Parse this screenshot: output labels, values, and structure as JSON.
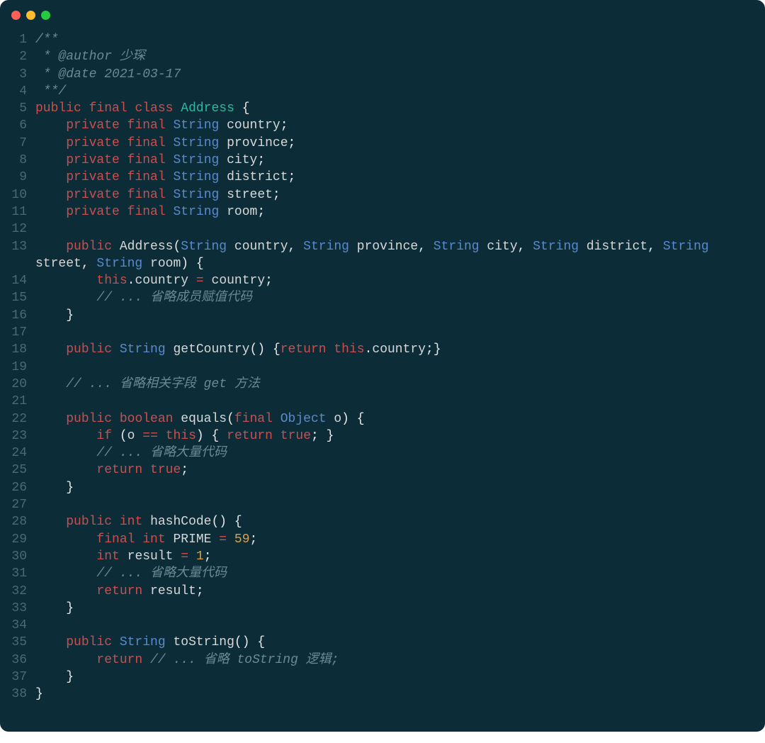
{
  "titlebar": {
    "buttons": [
      {
        "name": "close",
        "color": "#ff5f56"
      },
      {
        "name": "minimize",
        "color": "#ffbd2e"
      },
      {
        "name": "zoom",
        "color": "#27c93f"
      }
    ]
  },
  "line_count": 38,
  "code": {
    "comment_open": "/**",
    "author_prefix": " * @author ",
    "author": "少琛",
    "date_prefix": " * @date ",
    "date": "2021-03-17",
    "comment_close": " **/",
    "kw_public": "public",
    "kw_final": "final",
    "kw_class": "class",
    "class_name": "Address",
    "brace_open": "{",
    "brace_close": "}",
    "kw_private": "private",
    "type_String": "String",
    "fields": {
      "f1": "country",
      "f2": "province",
      "f3": "city",
      "f4": "district",
      "f5": "street",
      "f6": "room"
    },
    "semi": ";",
    "ctor_name": "Address",
    "paren_open": "(",
    "paren_close": ")",
    "comma_sp": ", ",
    "sp": " ",
    "kw_this": "this",
    "dot": ".",
    "eq": "=",
    "assign_comment": "// ... 省略成员赋值代码",
    "getCountry": "getCountry",
    "kw_return": "return",
    "getters_comment": "// ... 省略相关字段 get 方法",
    "kw_boolean": "boolean",
    "equals": "equals",
    "type_Object": "Object",
    "param_o": "o",
    "kw_if": "if",
    "eqeq": "==",
    "kw_true": "true",
    "omit_lots": "// ... 省略大量代码",
    "kw_int": "int",
    "hashCode": "hashCode",
    "PRIME": "PRIME",
    "prime_val": "59",
    "result": "result",
    "one": "1",
    "toString": "toString",
    "tostring_comment": "// ... 省略 toString 逻辑;"
  }
}
